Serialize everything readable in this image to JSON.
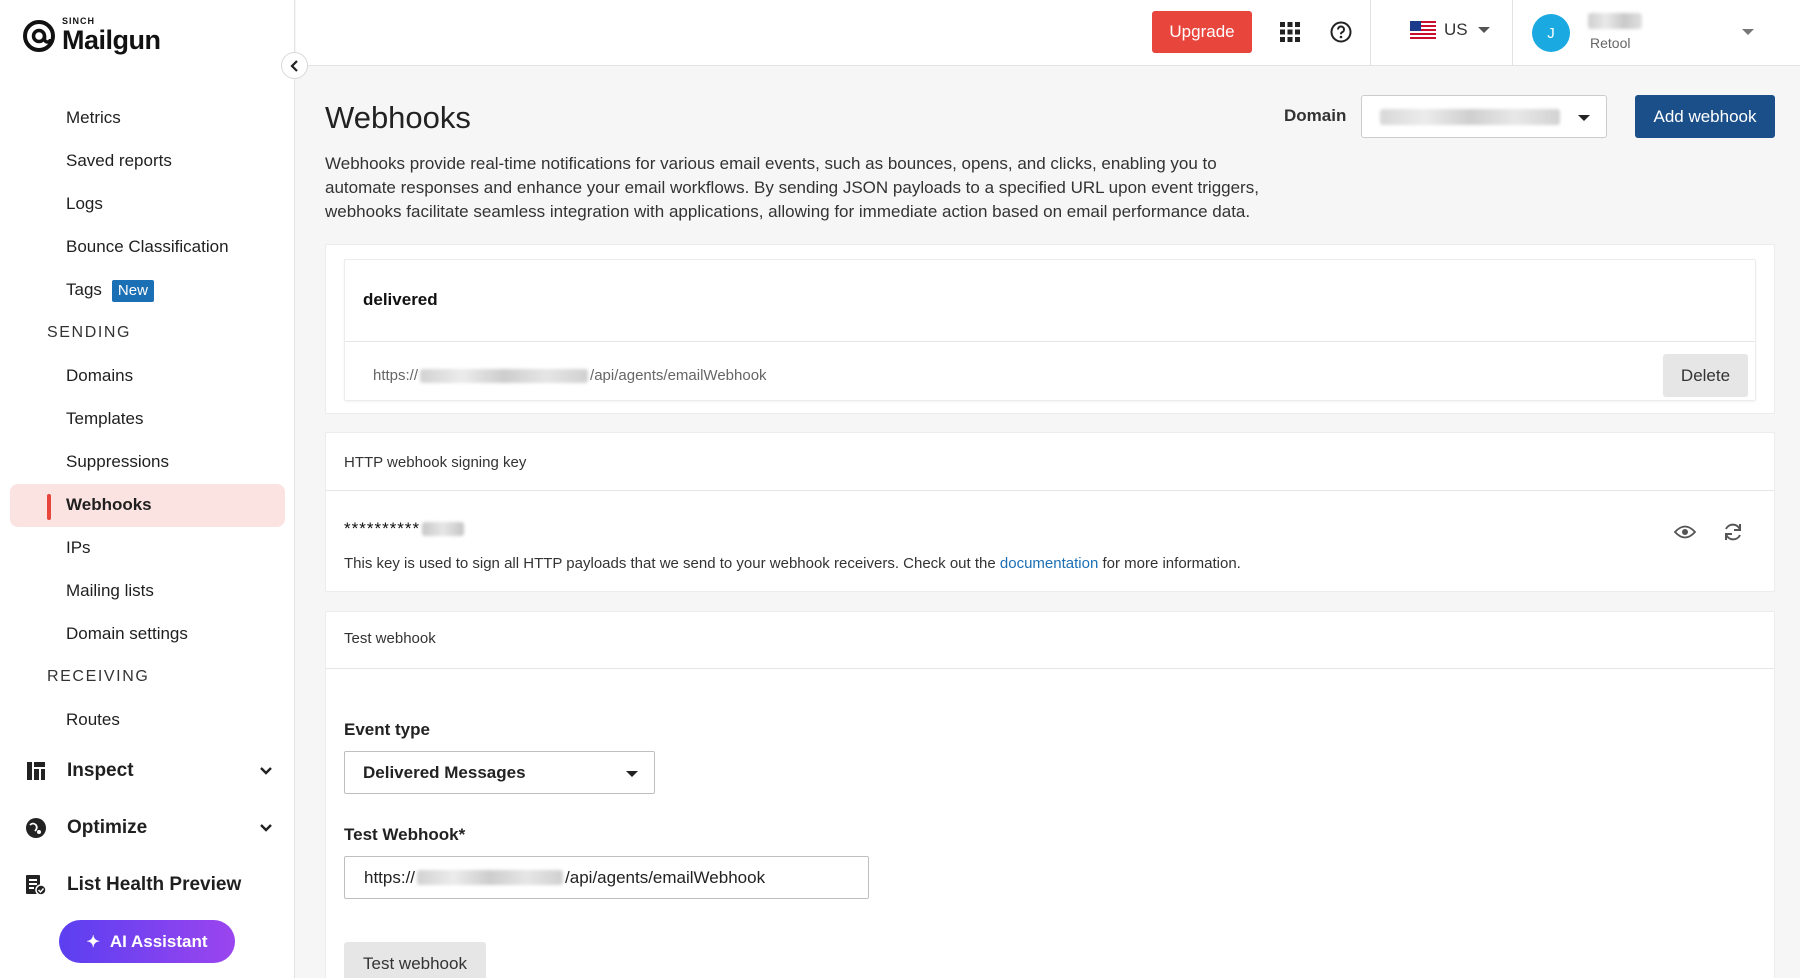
{
  "brand": {
    "small": "SINCH",
    "name": "Mailgun"
  },
  "sidebar": {
    "items": [
      {
        "label": "Metrics"
      },
      {
        "label": "Saved reports"
      },
      {
        "label": "Logs"
      },
      {
        "label": "Bounce Classification"
      },
      {
        "label": "Tags",
        "badge": "New"
      }
    ],
    "sending_title": "SENDING",
    "sending": [
      {
        "label": "Domains"
      },
      {
        "label": "Templates"
      },
      {
        "label": "Suppressions"
      },
      {
        "label": "Webhooks",
        "active": true
      },
      {
        "label": "IPs"
      },
      {
        "label": "Mailing lists"
      },
      {
        "label": "Domain settings"
      }
    ],
    "receiving_title": "RECEIVING",
    "receiving": [
      {
        "label": "Routes"
      }
    ],
    "groups": [
      {
        "label": "Inspect",
        "icon": "inspect-icon"
      },
      {
        "label": "Optimize",
        "icon": "optimize-icon"
      },
      {
        "label": "List Health Preview",
        "icon": "list-health-icon"
      }
    ],
    "ai_button": "AI Assistant"
  },
  "topbar": {
    "upgrade": "Upgrade",
    "region": "US",
    "user": {
      "initial": "J",
      "org": "Retool"
    }
  },
  "main": {
    "title": "Webhooks",
    "domain_label": "Domain",
    "add_button": "Add webhook",
    "intro": "Webhooks provide real-time notifications for various email events, such as bounces, opens, and clicks, enabling you to automate responses and enhance your email workflows. By sending JSON payloads to a specified URL upon event triggers, webhooks facilitate seamless integration with applications, allowing for immediate action based on email performance data.",
    "webhook": {
      "event": "delivered",
      "url_prefix": "https://",
      "url_suffix": "/api/agents/emailWebhook",
      "delete": "Delete"
    },
    "signing": {
      "title": "HTTP webhook signing key",
      "masked": "**********",
      "note_before": "This key is used to sign all HTTP payloads that we send to your webhook receivers. Check out the ",
      "link": "documentation",
      "note_after": " for more information."
    },
    "test": {
      "title": "Test webhook",
      "event_label": "Event type",
      "event_value": "Delivered Messages",
      "url_label": "Test Webhook*",
      "url_prefix": "https://",
      "url_suffix": "/api/agents/emailWebhook",
      "button": "Test webhook"
    }
  },
  "colors": {
    "accent": "#e8453c",
    "primary": "#1b4f8a",
    "link": "#1b6fb5",
    "active_bg": "#fbe3e2"
  }
}
